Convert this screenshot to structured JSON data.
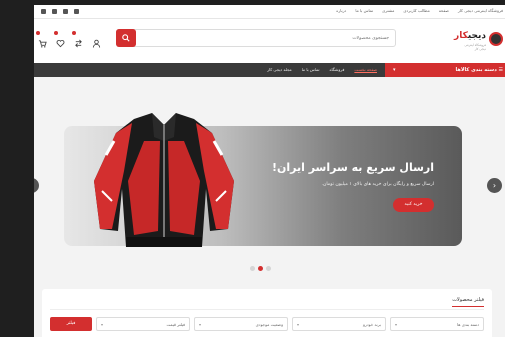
{
  "topbar": {
    "links": [
      "فروشگاه اینترنتی دیجی کار",
      "صفحه",
      "مطالب کاربردی",
      "مشتری",
      "تماس با ما",
      "درباره"
    ],
    "social_icons": [
      "facebook-icon",
      "twitter-icon",
      "youtube-icon",
      "instagram-icon"
    ]
  },
  "header": {
    "logo_part1": "دیجی",
    "logo_part2": "کار",
    "logo_tagline": "فروشگاه اینترنتی دیجی کار",
    "search_placeholder": "جستجوی محصولات",
    "accent": "#d32f2f"
  },
  "nav": {
    "categories_label": "دسته بندی کالاها",
    "links": [
      "صفحه نخست",
      "فروشگاه",
      "تماس با ما",
      "مجله دیجی کار"
    ]
  },
  "slider": {
    "title": "ارسال سریع به سراسر ایران!",
    "subtitle": "ارسال سریع و رایگان برای خرید های بالای ۱ میلیون تومان.",
    "button": "خرید کنید",
    "active_dot": 1,
    "dot_count": 3
  },
  "filter": {
    "title": "فیلتر محصولات",
    "selects": [
      "دسته بندی ها",
      "برند خودرو",
      "وضعیت موجودی",
      "فیلتر قیمت"
    ],
    "button": "فیلتر"
  }
}
